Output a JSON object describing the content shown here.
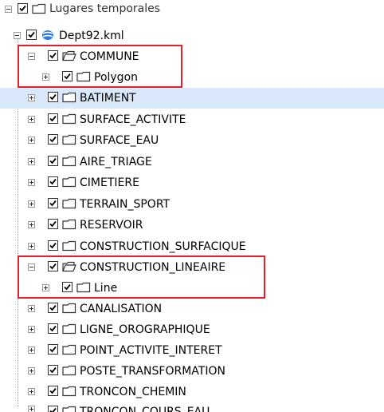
{
  "tree": {
    "top_partial_label": "Lugares temporales",
    "root": {
      "label": "Dept92.kml"
    },
    "commune": {
      "label": "COMMUNE",
      "child": "Polygon"
    },
    "construction_lineaire": {
      "label": "CONSTRUCTION_LINEAIRE",
      "child": "Line"
    },
    "folders_a": [
      "BATIMENT",
      "SURFACE_ACTIVITE",
      "SURFACE_EAU",
      "AIRE_TRIAGE",
      "CIMETIERE",
      "TERRAIN_SPORT",
      "RESERVOIR",
      "CONSTRUCTION_SURFACIQUE"
    ],
    "folders_b": [
      "CANALISATION",
      "LIGNE_OROGRAPHIQUE",
      "POINT_ACTIVITE_INTERET",
      "POSTE_TRANSFORMATION",
      "TRONCON_CHEMIN"
    ],
    "bottom_partial_label": "TRONCON_COURS_EAU",
    "selected_item": "BATIMENT"
  },
  "colors": {
    "selection": "#d9e9fb",
    "highlight_box": "#e0202a",
    "folder": "#ffffff",
    "kml_globe": "#2f7bd6"
  },
  "icons": {
    "expander": "expand-collapse-icon",
    "checkbox": "checkbox-checked-icon",
    "folder": "folder-icon",
    "open_folder": "open-folder-icon",
    "kml": "kml-globe-icon"
  }
}
